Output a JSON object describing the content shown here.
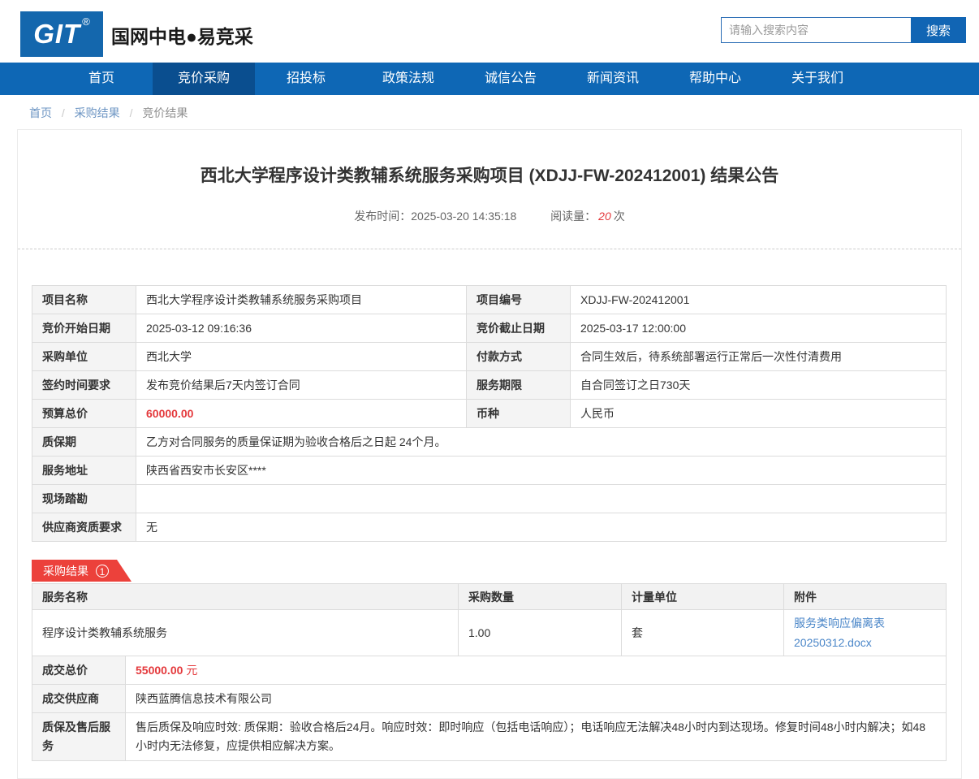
{
  "colors": {
    "nav_blue": "#0e67b5",
    "nav_active_blue": "#0a4e8f",
    "logo_blue": "#1467ad",
    "accent_red": "#ec413b",
    "price_red": "#e4393c",
    "link_blue": "#4a86c8"
  },
  "header": {
    "logo_text": "GIT",
    "logo_reg": "®",
    "brand": "国网中电●易竞采",
    "search": {
      "placeholder": "请输入搜索内容",
      "button": "搜索"
    }
  },
  "nav": {
    "items": [
      {
        "label": "首页",
        "active": false
      },
      {
        "label": "竞价采购",
        "active": true
      },
      {
        "label": "招投标",
        "active": false
      },
      {
        "label": "政策法规",
        "active": false
      },
      {
        "label": "诚信公告",
        "active": false
      },
      {
        "label": "新闻资讯",
        "active": false
      },
      {
        "label": "帮助中心",
        "active": false
      },
      {
        "label": "关于我们",
        "active": false
      }
    ]
  },
  "breadcrumb": {
    "separator": "/",
    "items": [
      "首页",
      "采购结果",
      "竞价结果"
    ]
  },
  "article": {
    "title": "西北大学程序设计类教辅系统服务采购项目 (XDJJ-FW-202412001) 结果公告",
    "publish_label": "发布时间：",
    "publish_time": "2025-03-20 14:35:18",
    "views_label": "阅读量：",
    "views_count": "20",
    "views_unit": "次"
  },
  "info_table": {
    "rows_paired": [
      {
        "label1": "项目名称",
        "value1": "西北大学程序设计类教辅系统服务采购项目",
        "label2": "项目编号",
        "value2": "XDJJ-FW-202412001"
      },
      {
        "label1": "竞价开始日期",
        "value1": "2025-03-12 09:16:36",
        "label2": "竞价截止日期",
        "value2": "2025-03-17 12:00:00"
      },
      {
        "label1": "采购单位",
        "value1": "西北大学",
        "label2": "付款方式",
        "value2": "合同生效后，待系统部署运行正常后一次性付清费用"
      },
      {
        "label1": "签约时间要求",
        "value1": "发布竞价结果后7天内签订合同",
        "label2": "服务期限",
        "value2": "自合同签订之日730天"
      },
      {
        "label1": "预算总价",
        "value1": "60000.00",
        "label2": "币种",
        "value2": "人民币"
      }
    ],
    "rows_full": [
      {
        "label": "质保期",
        "value": "乙方对合同服务的质量保证期为验收合格后之日起 24个月。"
      },
      {
        "label": "服务地址",
        "value": "陕西省西安市长安区****"
      },
      {
        "label": "现场踏勘",
        "value": ""
      },
      {
        "label": "供应商资质要求",
        "value": "无"
      }
    ]
  },
  "result_section": {
    "badge_label": "采购结果",
    "badge_count": "1",
    "table": {
      "headers": [
        "服务名称",
        "采购数量",
        "计量单位",
        "附件"
      ],
      "rows": [
        {
          "name": "程序设计类教辅系统服务",
          "qty": "1.00",
          "unit": "套",
          "attachment": "服务类响应偏离表 20250312.docx"
        }
      ]
    },
    "summary": [
      {
        "label": "成交总价",
        "amount": "55000.00",
        "unit": "元"
      },
      {
        "label": "成交供应商",
        "value": "陕西蓝腾信息技术有限公司"
      },
      {
        "label": "质保及售后服务",
        "value": "售后质保及响应时效: 质保期：验收合格后24月。响应时效：即时响应（包括电话响应）；电话响应无法解决48小时内到达现场。修复时间48小时内解决；如48小时内无法修复，应提供相应解决方案。"
      }
    ]
  }
}
